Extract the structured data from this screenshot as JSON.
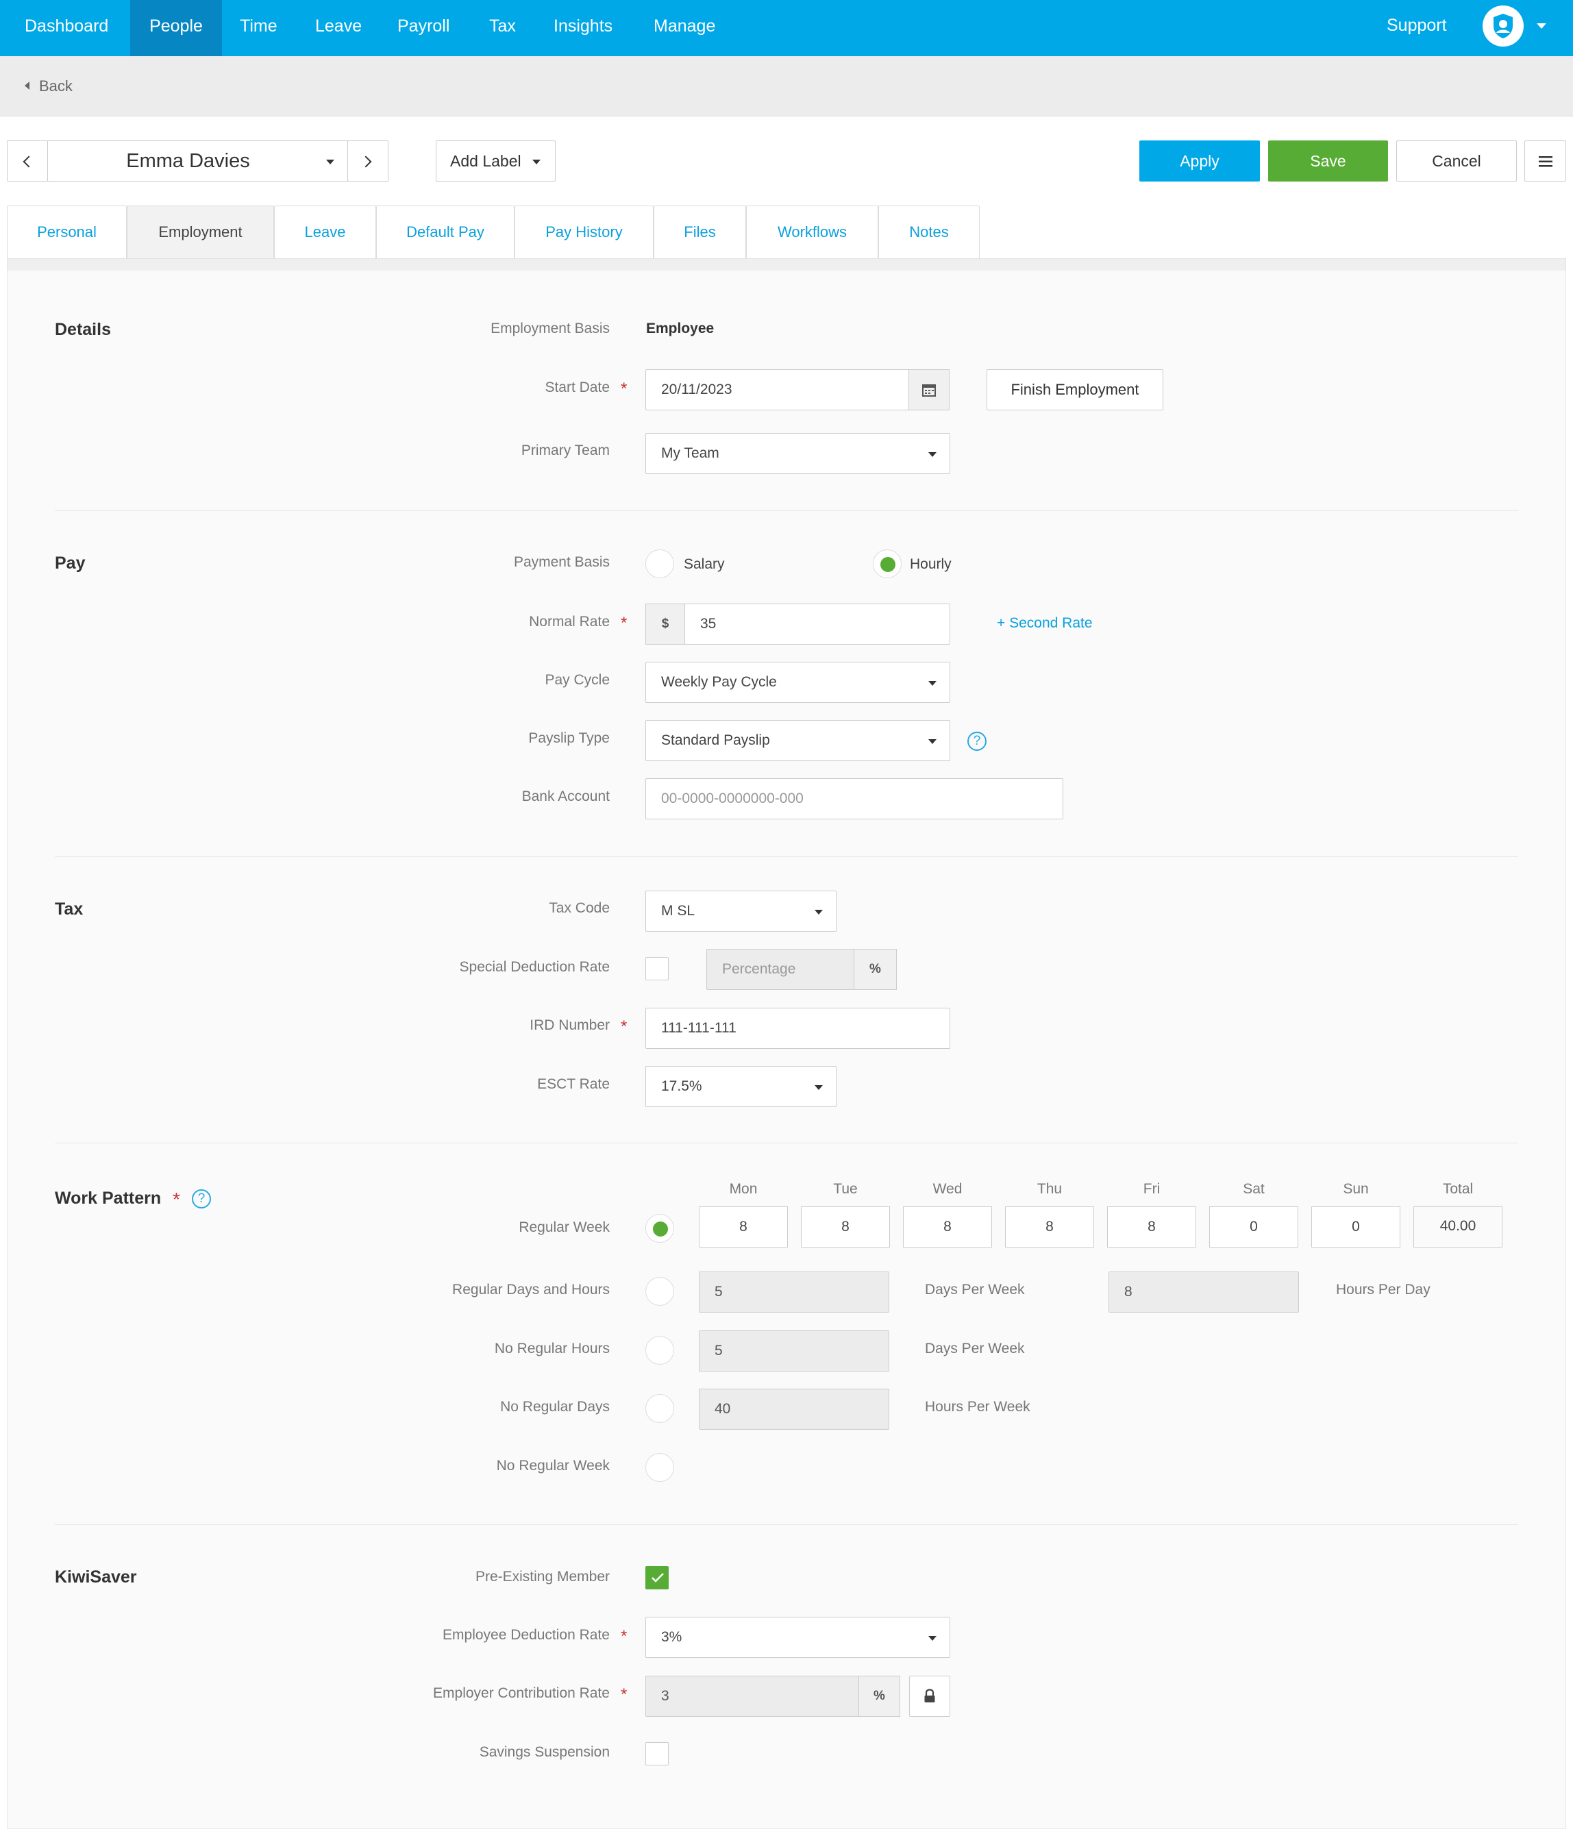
{
  "nav": {
    "items": [
      "Dashboard",
      "People",
      "Time",
      "Leave",
      "Payroll",
      "Tax",
      "Insights",
      "Manage"
    ],
    "active": "People",
    "support": "Support"
  },
  "back": {
    "label": "Back"
  },
  "toolbar": {
    "employee_name": "Emma Davies",
    "add_label": "Add Label",
    "apply": "Apply",
    "save": "Save",
    "cancel": "Cancel"
  },
  "tabs": [
    "Personal",
    "Employment",
    "Leave",
    "Default Pay",
    "Pay History",
    "Files",
    "Workflows",
    "Notes"
  ],
  "active_tab": "Employment",
  "details": {
    "title": "Details",
    "employment_basis_label": "Employment Basis",
    "employment_basis_value": "Employee",
    "start_date_label": "Start Date",
    "start_date_value": "20/11/2023",
    "finish_employment": "Finish Employment",
    "primary_team_label": "Primary Team",
    "primary_team_value": "My Team"
  },
  "pay": {
    "title": "Pay",
    "payment_basis_label": "Payment Basis",
    "salary": "Salary",
    "hourly": "Hourly",
    "selected_basis": "Hourly",
    "normal_rate_label": "Normal Rate",
    "currency": "$",
    "normal_rate_value": "35",
    "second_rate": "+ Second Rate",
    "pay_cycle_label": "Pay Cycle",
    "pay_cycle_value": "Weekly Pay Cycle",
    "payslip_type_label": "Payslip Type",
    "payslip_type_value": "Standard Payslip",
    "bank_account_label": "Bank Account",
    "bank_account_placeholder": "00-0000-0000000-000"
  },
  "tax": {
    "title": "Tax",
    "tax_code_label": "Tax Code",
    "tax_code_value": "M SL",
    "special_deduction_label": "Special Deduction Rate",
    "special_deduction_checked": false,
    "percentage_placeholder": "Percentage",
    "percent_sign": "%",
    "ird_label": "IRD Number",
    "ird_value": "111-111-111",
    "esct_label": "ESCT Rate",
    "esct_value": "17.5%"
  },
  "work_pattern": {
    "title": "Work Pattern",
    "days": [
      "Mon",
      "Tue",
      "Wed",
      "Thu",
      "Fri",
      "Sat",
      "Sun",
      "Total"
    ],
    "regular_week_label": "Regular Week",
    "hours": [
      "8",
      "8",
      "8",
      "8",
      "8",
      "0",
      "0",
      "40.00"
    ],
    "regular_days_hours_label": "Regular Days and Hours",
    "rdh_days": "5",
    "days_per_week": "Days Per Week",
    "rdh_hours": "8",
    "hours_per_day": "Hours Per Day",
    "no_regular_hours_label": "No Regular Hours",
    "nrh_days": "5",
    "no_regular_days_label": "No Regular Days",
    "nrd_hours": "40",
    "hours_per_week": "Hours Per Week",
    "no_regular_week_label": "No Regular Week",
    "selected": "Regular Week"
  },
  "kiwisaver": {
    "title": "KiwiSaver",
    "pre_existing_label": "Pre-Existing Member",
    "pre_existing_checked": true,
    "employee_deduction_label": "Employee Deduction Rate",
    "employee_deduction_value": "3%",
    "employer_contribution_label": "Employer Contribution Rate",
    "employer_contribution_value": "3",
    "percent_sign": "%",
    "savings_suspension_label": "Savings Suspension",
    "savings_suspension_checked": false
  },
  "colors": {
    "nav_blue": "#00a8e8",
    "nav_active": "#0687c4",
    "save_green": "#56ac34",
    "link_blue": "#0aa0de",
    "required_red": "#c9302c"
  }
}
